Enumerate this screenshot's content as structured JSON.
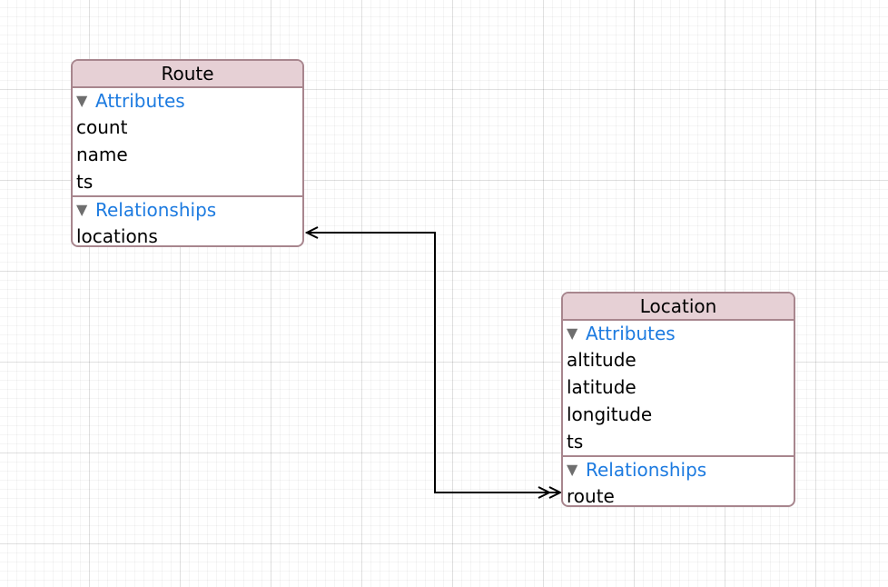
{
  "entities": {
    "route": {
      "name": "Route",
      "attributes_label": "Attributes",
      "attributes": [
        "count",
        "name",
        "ts"
      ],
      "relationships_label": "Relationships",
      "relationships": [
        "locations"
      ]
    },
    "location": {
      "name": "Location",
      "attributes_label": "Attributes",
      "attributes": [
        "altitude",
        "latitude",
        "longitude",
        "ts"
      ],
      "relationships_label": "Relationships",
      "relationships": [
        "route"
      ]
    }
  },
  "relationship_links": [
    {
      "from": "Route.locations",
      "to": "Location.route",
      "to_many_end": "Location.route"
    }
  ],
  "colors": {
    "header_fill": "#e6d0d5",
    "border": "#a8868e",
    "section_label": "#1d7be0",
    "grid": "#e5e5e5"
  }
}
